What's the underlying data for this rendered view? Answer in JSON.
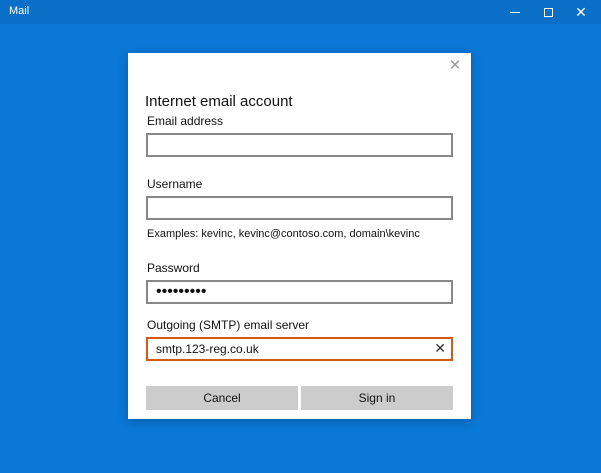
{
  "window": {
    "title": "Mail",
    "minimize_icon": "minimize-icon",
    "maximize_icon": "maximize-icon",
    "close_icon": "close-icon",
    "close_glyph": "✕"
  },
  "dialog": {
    "close_glyph": "✕",
    "title": "Internet email account",
    "email": {
      "label": "Email address",
      "value": ""
    },
    "username": {
      "label": "Username",
      "value": ""
    },
    "username_hint": "Examples: kevinc, kevinc@contoso.com, domain\\kevinc",
    "password": {
      "label": "Password",
      "masked_value": "•••••••••"
    },
    "smtp": {
      "label": "Outgoing (SMTP) email server",
      "value": "smtp.123-reg.co.uk",
      "clear_glyph": "✕"
    },
    "buttons": {
      "cancel": "Cancel",
      "sign_in": "Sign in"
    }
  },
  "colors": {
    "background": "#0a78d7",
    "titlebar": "#0a6fc7",
    "focus_border": "#d05a1a",
    "button": "#cccccc"
  }
}
